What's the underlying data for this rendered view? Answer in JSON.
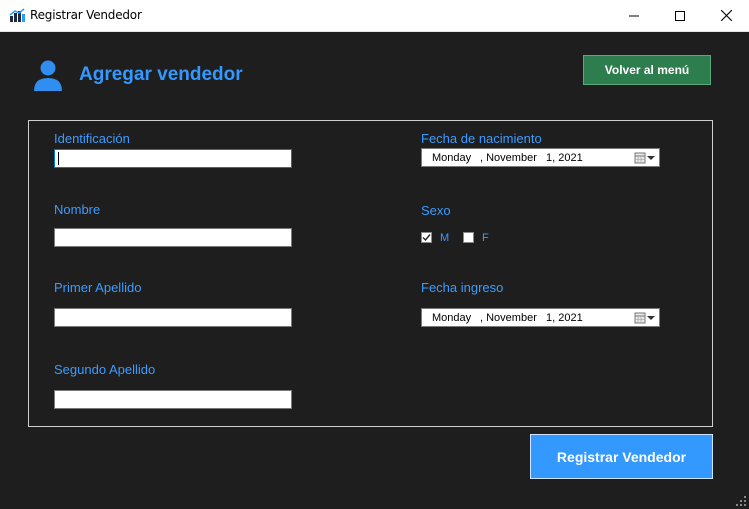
{
  "window": {
    "title": "Registrar Vendedor",
    "icon": "bar-chart-icon"
  },
  "header": {
    "title": "Agregar vendedor",
    "icon": "user-icon",
    "back_button": "Volver al menú"
  },
  "form": {
    "identificacion": {
      "label": "Identificación",
      "value": ""
    },
    "nombre": {
      "label": "Nombre",
      "value": ""
    },
    "primer_apellido": {
      "label": "Primer Apellido",
      "value": ""
    },
    "segundo_apellido": {
      "label": "Segundo Apellido",
      "value": ""
    },
    "fecha_nacimiento": {
      "label": "Fecha de nacimiento",
      "day": "Monday",
      "month": ", November",
      "date": "1, 2021"
    },
    "sexo": {
      "label": "Sexo",
      "options": [
        {
          "label": "M",
          "checked": true
        },
        {
          "label": "F",
          "checked": false
        }
      ]
    },
    "fecha_ingreso": {
      "label": "Fecha ingreso",
      "day": "Monday",
      "month": ", November",
      "date": "1, 2021"
    }
  },
  "actions": {
    "register_button": "Registrar Vendedor"
  },
  "colors": {
    "background": "#1e1e1e",
    "accent": "#3399ff",
    "back_button": "#2e7d4f"
  }
}
